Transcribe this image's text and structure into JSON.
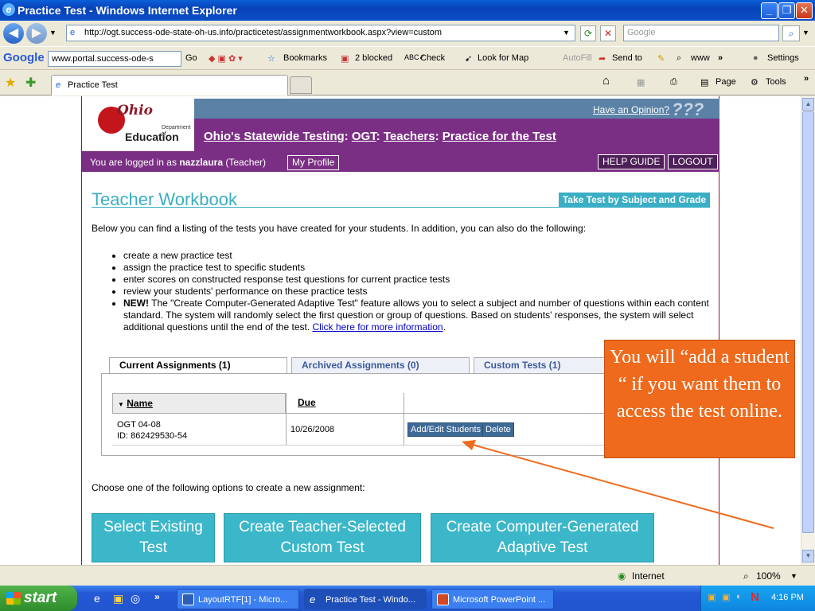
{
  "window": {
    "title": "Practice Test - Windows Internet Explorer",
    "minimize": "_",
    "restore": "❐",
    "close": "✕"
  },
  "address": {
    "url": "http://ogt.success-ode-state-oh-us.info/practicetest/assignmentworkbook.aspx?view=custom",
    "search_placeholder": "Google"
  },
  "google_toolbar": {
    "logo": "Google",
    "input": "www.portal.success-ode-s",
    "go": "Go",
    "bookmarks": "Bookmarks",
    "blocked": "2 blocked",
    "check": "Check",
    "look_for_map": "Look for Map",
    "autofill": "AutoFill",
    "send_to": "Send to",
    "www": "www",
    "settings": "Settings"
  },
  "tabs": {
    "active": "Practice Test",
    "page_menu": "Page",
    "tools_menu": "Tools"
  },
  "site": {
    "logo_brand": "Ohio",
    "logo_dept": "Department of",
    "logo_edu": "Education",
    "opinion": "Have an Opinion?",
    "qmarks": "???",
    "crumbs": [
      "Ohio's Statewide Testing",
      "OGT",
      "Teachers",
      "Practice for the Test"
    ],
    "logged_in_prefix": "You are logged in as",
    "username": "nazzlaura",
    "role": "(Teacher)",
    "my_profile": "My Profile",
    "help_guide": "HELP GUIDE",
    "logout": "LOGOUT"
  },
  "workbook": {
    "title": "Teacher Workbook",
    "take_test": "Take Test by Subject and Grade",
    "intro": "Below you can find a listing of the tests you have created for your students. In addition, you can also do the following:",
    "bullets": [
      "create a new practice test",
      "assign the practice test to specific students",
      "enter scores on constructed response test questions for current practice tests",
      "review your students' performance on these practice tests"
    ],
    "new_label": "NEW!",
    "new_text": "The \"Create Computer-Generated Adaptive Test\" feature allows you to select a subject and number of questions within each content standard. The system will randomly select the first question or group of questions. Based on students' responses, the system will select additional questions until the end of the test.",
    "more_info": "Click here for more information"
  },
  "assignment_tabs": [
    "Current Assignments (1)",
    "Archived Assignments (0)",
    "Custom Tests (1)"
  ],
  "table": {
    "col_name": "Name",
    "col_due": "Due",
    "row": {
      "name": "OGT 04-08",
      "id": "ID: 862429530-54",
      "due": "10/26/2008",
      "add_edit": "Add/Edit Students",
      "delete": "Delete"
    }
  },
  "create": {
    "prompt": "Choose one of the following options to create a new assignment:",
    "select_existing": "Select Existing Test",
    "teacher_selected": "Create Teacher-Selected Custom Test",
    "computer_generated": "Create Computer-Generated Adaptive Test"
  },
  "callout": {
    "text": "You will “add a student “ if you want them to access the test online.",
    "color": "#ef6a1c"
  },
  "status": {
    "zone": "Internet",
    "zoom": "100%"
  },
  "taskbar": {
    "start": "start",
    "items": [
      "LayoutRTF[1] - Micro...",
      "Practice Test - Windo...",
      "Microsoft PowerPoint ..."
    ],
    "clock": "4:16 PM"
  }
}
